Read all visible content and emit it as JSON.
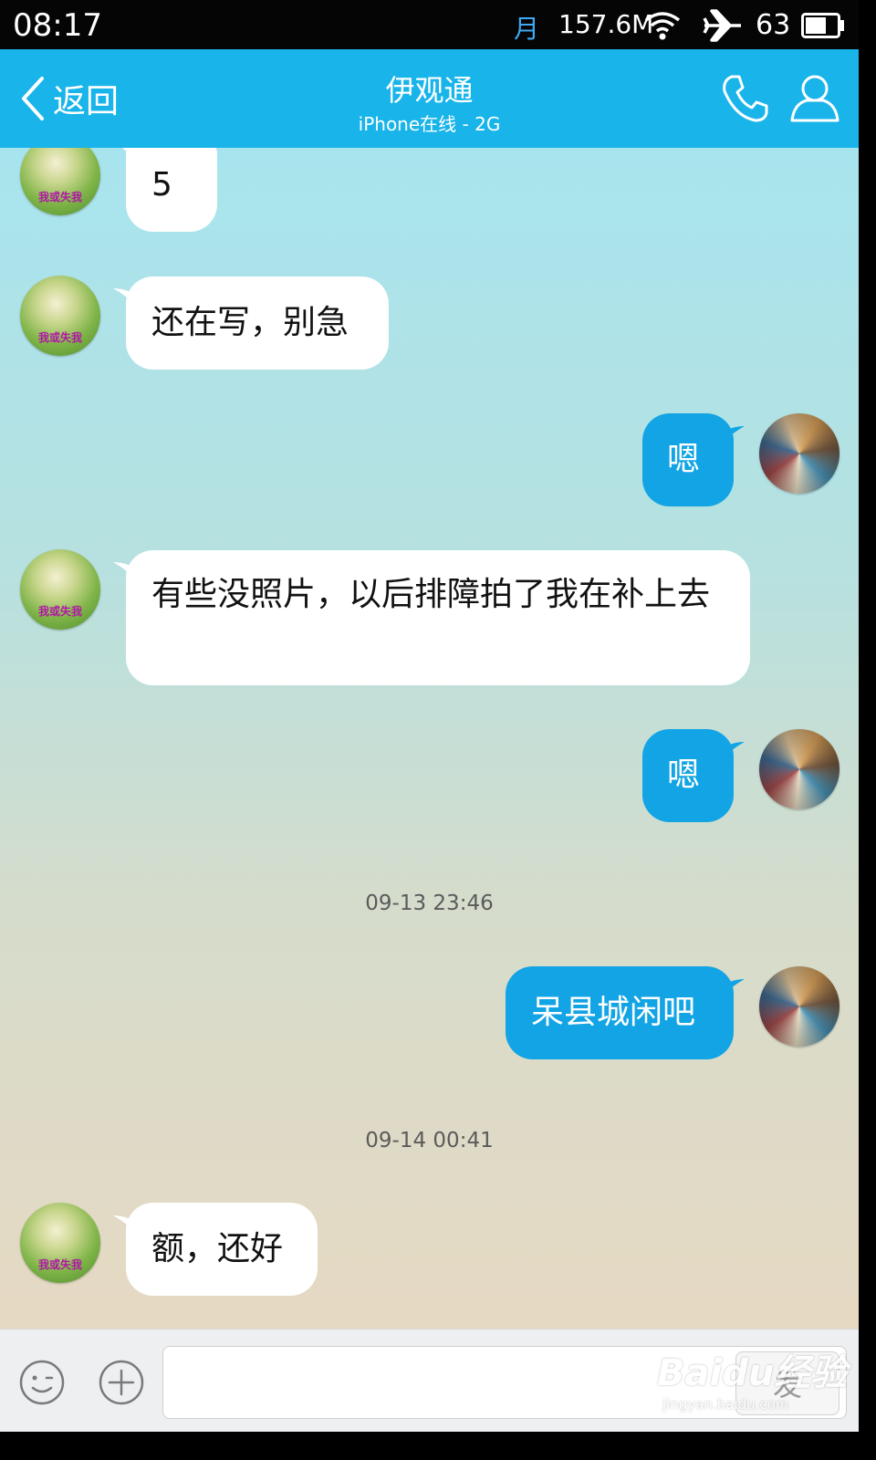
{
  "status_bar": {
    "time": "08:17",
    "moon_icon": "moon-icon",
    "moon_glyph": "月",
    "data_speed": "157.6M",
    "battery_level": "63"
  },
  "header": {
    "back_label": "返回",
    "contact_name": "伊观通",
    "contact_status": "iPhone在线 - 2G"
  },
  "messages": [
    {
      "side": "in",
      "text": "5"
    },
    {
      "side": "in",
      "text": "还在写，别急"
    },
    {
      "side": "out",
      "text": "嗯"
    },
    {
      "side": "in",
      "text": "有些没照片，以后排障拍了我在补上去"
    },
    {
      "side": "out",
      "text": "嗯"
    },
    {
      "side": "out",
      "text": "呆县城闲吧"
    },
    {
      "side": "in",
      "text": "额，还好"
    }
  ],
  "timestamps": [
    "09-13 23:46",
    "09-14 00:41"
  ],
  "avatar_caption": "我或失我",
  "input_bar": {
    "placeholder": "",
    "send_label": "发"
  },
  "watermark": {
    "main": "Baidu经验",
    "sub": "jingyan.baidu.com"
  },
  "colors": {
    "header_bg": "#18b4ea",
    "outgoing_bubble": "#12a4e4",
    "incoming_bubble": "#ffffff"
  }
}
